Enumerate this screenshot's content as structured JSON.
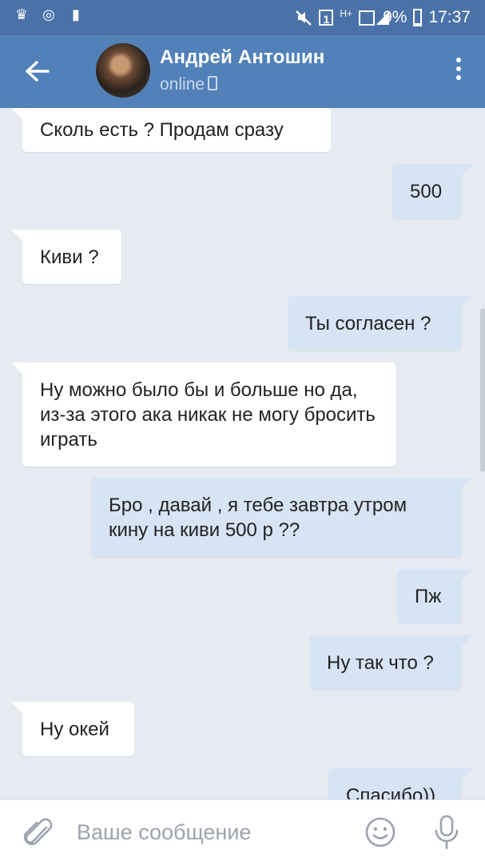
{
  "status_bar": {
    "battery_percent": "9%",
    "time": "17:37",
    "sim_slot": "1",
    "network": "H+",
    "icons": [
      "crown-icon",
      "shazam-icon",
      "notification-icon",
      "mute-icon",
      "sim-icon",
      "signal-icon",
      "battery-icon"
    ]
  },
  "header": {
    "contact_name": "Андрей Антошин",
    "status": "online",
    "icons": [
      "back-arrow-icon",
      "more-vert-icon",
      "phone-icon"
    ]
  },
  "messages": [
    {
      "side": "in",
      "text": "Сколь есть ? Продам сразу"
    },
    {
      "side": "out",
      "text": "500"
    },
    {
      "side": "in",
      "text": "Киви ?"
    },
    {
      "side": "out",
      "text": "Ты согласен ?"
    },
    {
      "side": "in",
      "text": "Ну можно было бы и больше но да, из-за этого ака никак не могу бросить играть"
    },
    {
      "side": "out",
      "text": "Бро , давай , я тебе завтра утром кину на киви 500 р ??"
    },
    {
      "side": "out",
      "text": "Пж"
    },
    {
      "side": "out",
      "text": "Ну так что ?"
    },
    {
      "side": "in",
      "text": "Ну окей"
    },
    {
      "side": "out",
      "text": "Спасибо))"
    }
  ],
  "composer": {
    "placeholder": "Ваше сообщение",
    "value": "",
    "icons": [
      "paperclip-icon",
      "emoji-icon",
      "mic-icon"
    ]
  },
  "colors": {
    "status_bar": "#4a72a8",
    "header": "#5181b8",
    "chat_bg": "#e6ebf1",
    "incoming_bubble": "#ffffff",
    "outgoing_bubble": "#d7e4f3"
  }
}
